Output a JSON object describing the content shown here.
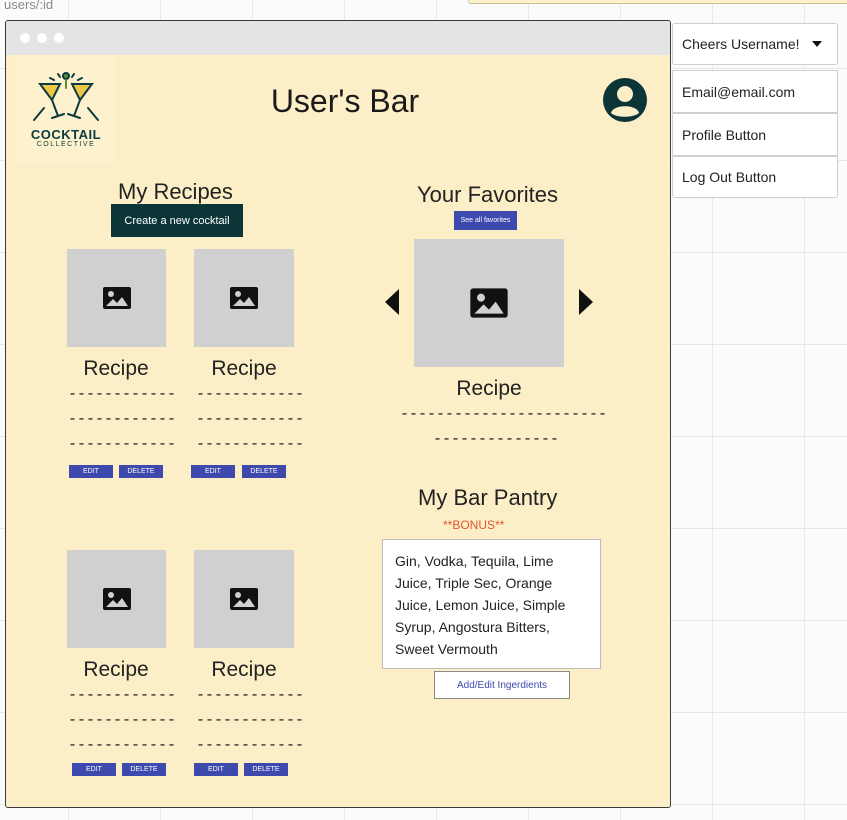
{
  "url_label": "users/:id",
  "app": {
    "logo_text": "COCKTAIL",
    "logo_subtext": "COLLECTIVE",
    "title": "User's Bar"
  },
  "recipes": {
    "heading": "My Recipes",
    "create_button": "Create a new cocktail",
    "cards": [
      {
        "title": "Recipe",
        "lines": [
          "------------",
          "------------",
          "------------"
        ],
        "edit": "EDIT",
        "delete": "DELETE"
      },
      {
        "title": "Recipe",
        "lines": [
          "------------",
          "------------",
          "------------"
        ],
        "edit": "EDIT",
        "delete": "DELETE"
      },
      {
        "title": "Recipe",
        "lines": [
          "------------",
          "------------",
          "------------"
        ],
        "edit": "EDIT",
        "delete": "DELETE"
      },
      {
        "title": "Recipe",
        "lines": [
          "------------",
          "------------",
          "------------"
        ],
        "edit": "EDIT",
        "delete": "DELETE"
      }
    ]
  },
  "favorites": {
    "heading": "Your Favorites",
    "see_all_button": "See all favorites",
    "card_title": "Recipe",
    "lines": [
      "-----------------------",
      "--------------"
    ]
  },
  "pantry": {
    "heading": "My Bar Pantry",
    "bonus": "**BONUS**",
    "ingredients_text": "Gin, Vodka, Tequila, Lime Juice, Triple Sec, Orange Juice, Lemon Juice, Simple Syrup, Angostura Bitters, Sweet Vermouth",
    "edit_button": "Add/Edit Ingerdients"
  },
  "user_menu": {
    "greeting": "Cheers Username!",
    "items": [
      "Email@email.com",
      "Profile Button",
      "Log Out Button"
    ]
  },
  "colors": {
    "page_bg": "#fcefc8",
    "dark_button": "#0c3538",
    "blue_button": "#3e49ad",
    "bonus_text": "#e0552d"
  }
}
